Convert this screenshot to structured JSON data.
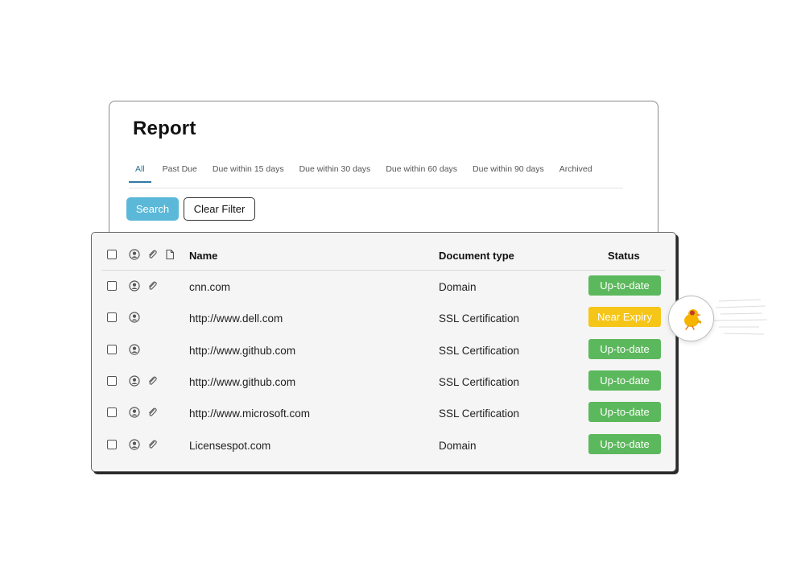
{
  "report": {
    "title": "Report",
    "tabs": [
      {
        "label": "All"
      },
      {
        "label": "Past Due"
      },
      {
        "label": "Due within 15 days"
      },
      {
        "label": "Due within 30 days"
      },
      {
        "label": "Due within 60 days"
      },
      {
        "label": "Due within 90 days"
      },
      {
        "label": "Archived"
      }
    ],
    "active_tab": "All",
    "buttons": {
      "search": "Search",
      "clear_filter": "Clear Filter"
    }
  },
  "table": {
    "headers": {
      "name": "Name",
      "document_type": "Document type",
      "status": "Status"
    },
    "header_icons": [
      "person-icon",
      "paperclip-icon",
      "document-icon"
    ],
    "rows": [
      {
        "name": "cnn.com",
        "document_type": "Domain",
        "status": "Up-to-date",
        "icons": [
          "person-icon",
          "paperclip-icon"
        ]
      },
      {
        "name": "http://www.dell.com",
        "document_type": "SSL Certification",
        "status": "Near Expiry",
        "icons": [
          "person-icon"
        ]
      },
      {
        "name": "http://www.github.com",
        "document_type": "SSL Certification",
        "status": "Up-to-date",
        "icons": [
          "person-icon"
        ]
      },
      {
        "name": "http://www.github.com",
        "document_type": "SSL Certification",
        "status": "Up-to-date",
        "icons": [
          "person-icon",
          "paperclip-icon"
        ]
      },
      {
        "name": "http://www.microsoft.com",
        "document_type": "SSL Certification",
        "status": "Up-to-date",
        "icons": [
          "person-icon",
          "paperclip-icon"
        ]
      },
      {
        "name": "Licensespot.com",
        "document_type": "Domain",
        "status": "Up-to-date",
        "icons": [
          "person-icon",
          "paperclip-icon"
        ]
      }
    ]
  },
  "colors": {
    "up_to_date": "#5cb85c",
    "near_expiry": "#f5c518",
    "accent_blue": "#5bb8d8",
    "tab_active": "#2f7aa3"
  },
  "decorations": {
    "notification_bubble": "running-chick-icon"
  }
}
